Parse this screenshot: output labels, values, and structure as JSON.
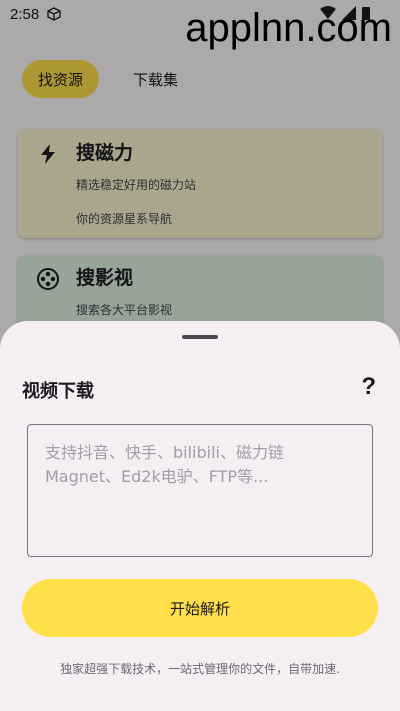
{
  "status_bar": {
    "time": "2:58"
  },
  "watermark": "applnn.com",
  "tabs": [
    {
      "label": "找资源",
      "active": true
    },
    {
      "label": "下载集",
      "active": false
    }
  ],
  "cards": [
    {
      "title": "搜磁力",
      "icon": "bolt-icon",
      "lines": [
        "精选稳定好用的磁力站",
        "你的资源星系导航"
      ]
    },
    {
      "title": "搜影视",
      "icon": "film-reel-icon",
      "lines": [
        "搜索各大平台影视"
      ]
    }
  ],
  "sheet": {
    "title": "视频下载",
    "help_icon": "?",
    "input": {
      "placeholder": "支持抖音、快手、bilibili、磁力链Magnet、Ed2k电驴、FTP等...",
      "value": ""
    },
    "primary_button": "开始解析",
    "footer": "独家超强下载技术，一站式管理你的文件，自带加速."
  },
  "colors": {
    "accent": "#ffdf4a",
    "sheet_bg": "#f5eff4",
    "card_yellow": "#fbf3cf",
    "card_green": "#dff2e0"
  }
}
